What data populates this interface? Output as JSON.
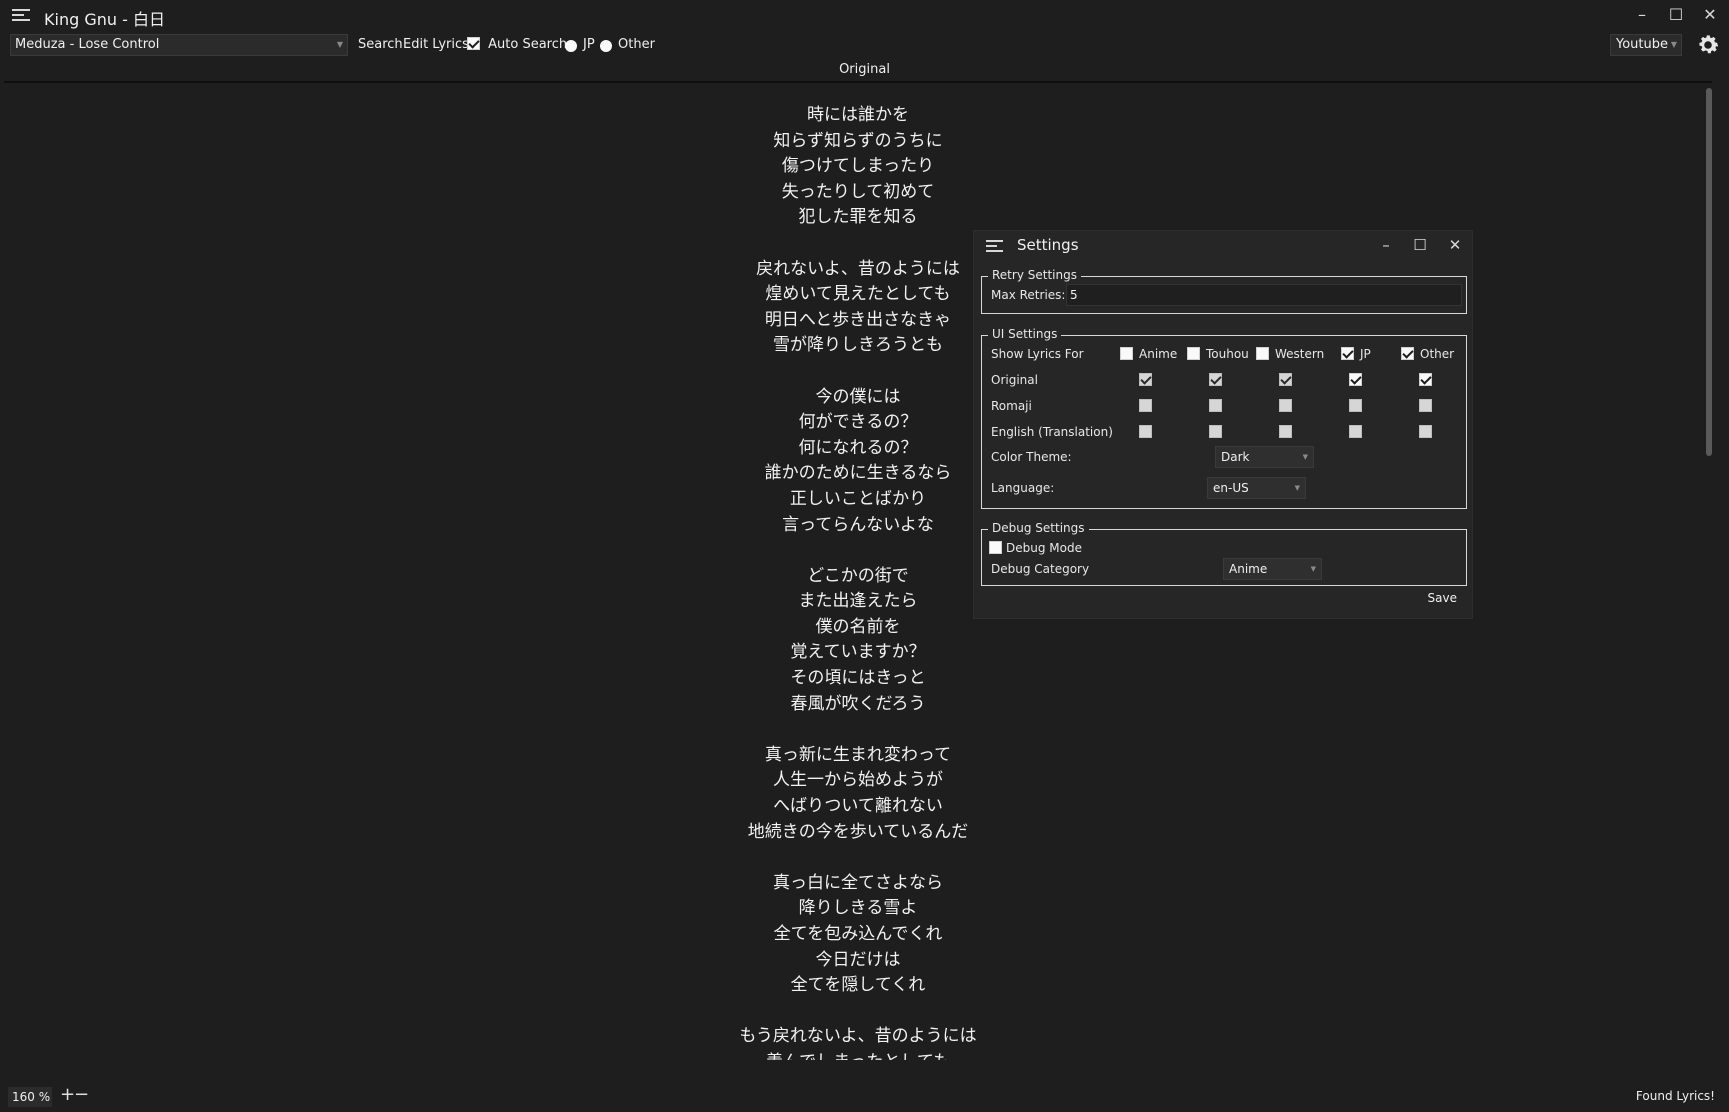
{
  "window": {
    "title": "King Gnu - 白日",
    "minimize": "–",
    "maximize": "☐",
    "close": "✕"
  },
  "toolbar": {
    "song_select": "Meduza - Lose Control",
    "search_label": "Search",
    "edit_lyrics_label": "Edit Lyrics",
    "auto_search_label": "Auto Search",
    "auto_search_checked": true,
    "radio_jp_label": "JP",
    "radio_other_label": "Other",
    "source_select": "Youtube"
  },
  "lyrics": {
    "column_header": "Original",
    "lines": [
      "時には誰かを",
      "知らず知らずのうちに",
      "傷つけてしまったり",
      "失ったりして初めて",
      "犯した罪を知る",
      "",
      "戻れないよ、昔のようには",
      "煌めいて見えたとしても",
      "明日へと歩き出さなきゃ",
      "雪が降りしきろうとも",
      "",
      "今の僕には",
      "何ができるの？",
      "何になれるの？",
      "誰かのために生きるなら",
      "正しいことばかり",
      "言ってらんないよな",
      "",
      "どこかの街で",
      "また出逢えたら",
      "僕の名前を",
      "覚えていますか？",
      "その頃にはきっと",
      "春風が吹くだろう",
      "",
      "真っ新に生まれ変わって",
      "人生一から始めようが",
      "へばりついて離れない",
      "地続きの今を歩いているんだ",
      "",
      "真っ白に全てさよなら",
      "降りしきる雪よ",
      "全てを包み込んでくれ",
      "今日だけは",
      "全てを隠してくれ",
      "",
      "もう戻れないよ、昔のようには",
      "羨んでしまったとしても"
    ]
  },
  "statusbar": {
    "zoom": "160 %",
    "zoom_in": "+",
    "zoom_out": "−",
    "status": "Found Lyrics!"
  },
  "settings": {
    "title": "Settings",
    "minimize": "–",
    "maximize": "☐",
    "close": "✕",
    "retry": {
      "group_label": "Retry Settings",
      "max_retries_label": "Max Retries:",
      "max_retries_value": "5"
    },
    "ui": {
      "group_label": "UI Settings",
      "show_lyrics_for_label": "Show Lyrics For",
      "categories": [
        {
          "label": "Anime",
          "checked": false
        },
        {
          "label": "Touhou",
          "checked": false
        },
        {
          "label": "Western",
          "checked": false
        },
        {
          "label": "JP",
          "checked": true
        },
        {
          "label": "Other",
          "checked": true
        }
      ],
      "rows": [
        {
          "label": "Original",
          "checked": [
            true,
            true,
            true,
            true,
            true
          ]
        },
        {
          "label": "Romaji",
          "checked": [
            false,
            false,
            false,
            false,
            false
          ]
        },
        {
          "label": "English (Translation)",
          "checked": [
            false,
            false,
            false,
            false,
            false
          ]
        }
      ],
      "color_theme_label": "Color Theme:",
      "color_theme_value": "Dark",
      "language_label": "Language:",
      "language_value": "en-US"
    },
    "debug": {
      "group_label": "Debug Settings",
      "debug_mode_label": "Debug Mode",
      "debug_mode_checked": false,
      "debug_category_label": "Debug Category",
      "debug_category_value": "Anime"
    },
    "save_label": "Save"
  }
}
